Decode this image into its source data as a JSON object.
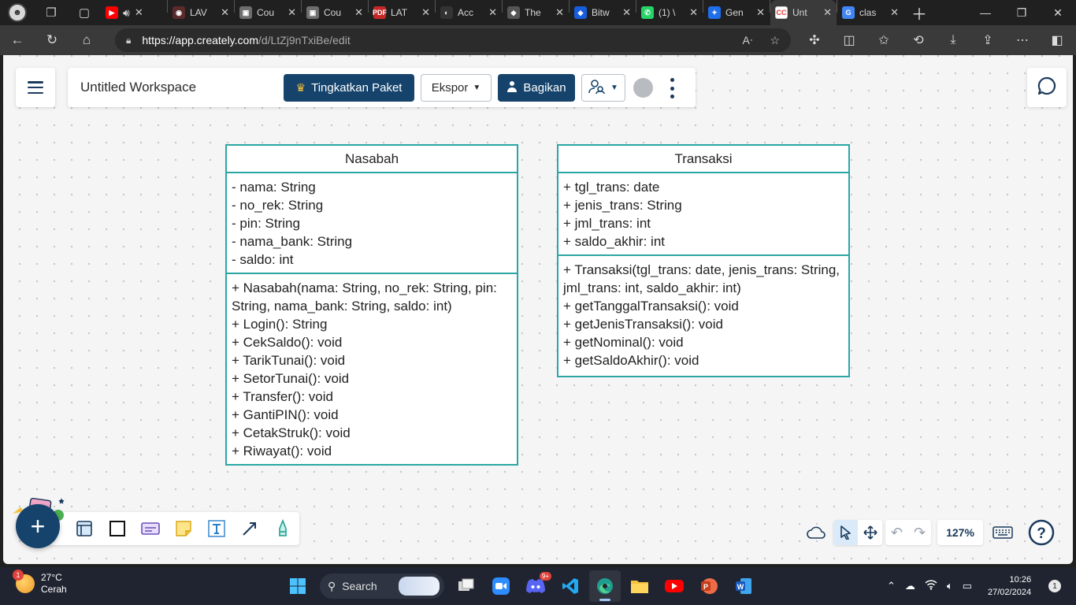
{
  "browser": {
    "tabs": [
      {
        "title": "LAV",
        "color": "#5b2b2b",
        "glyph": "◉"
      },
      {
        "title": "Cou",
        "color": "#6e6e6e",
        "glyph": "▣"
      },
      {
        "title": "Cou",
        "color": "#6e6e6e",
        "glyph": "▣"
      },
      {
        "title": "LAT",
        "color": "#c62828",
        "glyph": "PDF"
      },
      {
        "title": "Acc",
        "color": "#333333",
        "glyph": "◐"
      },
      {
        "title": "The",
        "color": "#555555",
        "glyph": "◆"
      },
      {
        "title": "Bitw",
        "color": "#175ddc",
        "glyph": "◈"
      },
      {
        "title": "(1) \\",
        "color": "#25d366",
        "glyph": "✆"
      },
      {
        "title": "Gen",
        "color": "#1f6feb",
        "glyph": "✦"
      },
      {
        "title": "Unt",
        "color": "#ffffff",
        "glyph": "CC",
        "active": true
      },
      {
        "title": "clas",
        "color": "#4285f4",
        "glyph": "G"
      }
    ],
    "url_domain": "https://app.creately.com",
    "url_path": "/d/LtZj9nTxiBe/edit"
  },
  "app": {
    "workspace_title": "Untitled Workspace",
    "upgrade_label": "Tingkatkan Paket",
    "export_label": "Ekspor",
    "share_label": "Bagikan",
    "zoom_label": "127%"
  },
  "diagram": {
    "classes": [
      {
        "name": "Nasabah",
        "attributes": [
          "- nama: String",
          "- no_rek: String",
          "- pin: String",
          "- nama_bank: String",
          "- saldo: int"
        ],
        "methods": [
          "+ Nasabah(nama: String, no_rek: String, pin: String, nama_bank: String, saldo: int)",
          "+ Login(): String",
          "+ CekSaldo(): void",
          "+ TarikTunai(): void",
          "+ SetorTunai(): void",
          "+ Transfer(): void",
          "+ GantiPIN(): void",
          "+ CetakStruk(): void",
          "+ Riwayat(): void"
        ]
      },
      {
        "name": "Transaksi",
        "attributes": [
          "+ tgl_trans: date",
          "+ jenis_trans: String",
          "+ jml_trans: int",
          "+ saldo_akhir: int"
        ],
        "methods": [
          "+ Transaksi(tgl_trans: date, jenis_trans: String, jml_trans: int, saldo_akhir: int)",
          "+ getTanggalTransaksi(): void",
          "+ getJenisTransaksi(): void",
          "+ getNominal(): void",
          "+ getSaldoAkhir(): void"
        ]
      }
    ]
  },
  "taskbar": {
    "weather_temp": "27°C",
    "weather_desc": "Cerah",
    "weather_badge": "1",
    "search_label": "Search",
    "discord_badge": "9+",
    "time": "10:26",
    "date": "27/02/2024",
    "notification_count": "1"
  },
  "colors": {
    "accent": "#15436b",
    "uml_border": "#2aa7a4"
  }
}
